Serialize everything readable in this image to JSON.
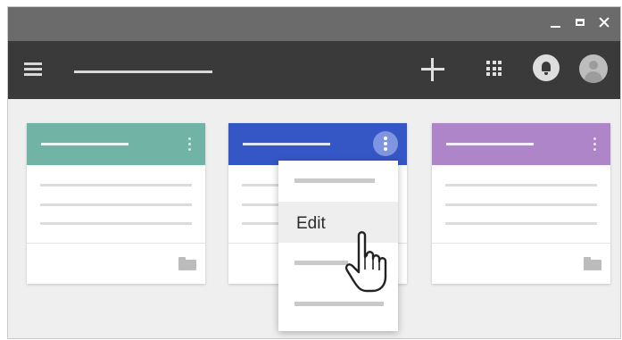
{
  "window": {
    "controls": [
      {
        "name": "minimize-button",
        "icon": "minimize-icon"
      },
      {
        "name": "maximize-button",
        "icon": "maximize-icon"
      },
      {
        "name": "close-button",
        "icon": "close-icon"
      }
    ]
  },
  "appbar": {
    "background": "#3a3a3a",
    "icons": [
      "menu-icon",
      "plus-icon",
      "apps-grid-icon",
      "notification-bell-icon",
      "avatar"
    ]
  },
  "cards": [
    {
      "header_color": "#71b4a6",
      "icons": [
        "more-vert-icon",
        "folder-icon"
      ]
    },
    {
      "header_color": "#3557c6",
      "icons": [
        "more-vert-icon",
        "folder-icon"
      ],
      "menu_open": true
    },
    {
      "header_color": "#ae85c8",
      "icons": [
        "more-vert-icon",
        "folder-icon"
      ]
    }
  ],
  "context_menu": {
    "items": [
      {
        "label": ""
      },
      {
        "label": "Edit",
        "highlighted": true
      },
      {
        "label": ""
      },
      {
        "label": ""
      }
    ]
  },
  "pointer": {
    "icon": "hand-pointer-icon"
  }
}
